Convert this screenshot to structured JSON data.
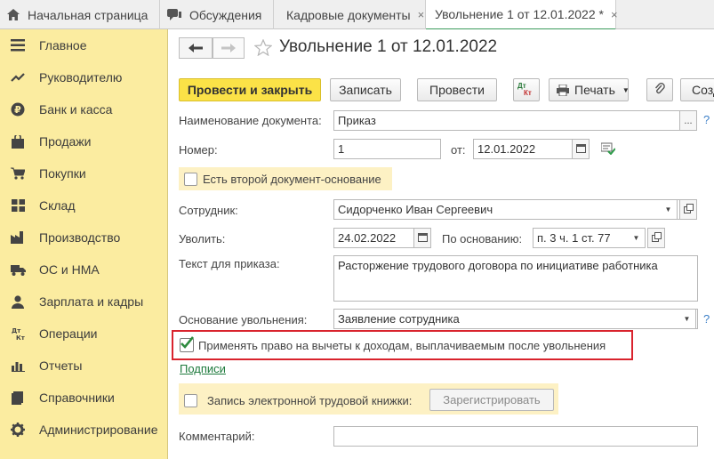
{
  "tabs": [
    {
      "label": "Начальная страница",
      "icon": "home-icon"
    },
    {
      "label": "Обсуждения",
      "icon": "chat-icon"
    },
    {
      "label": "Кадровые документы",
      "icon": ""
    },
    {
      "label": "Увольнение 1 от 12.01.2022 *",
      "icon": "",
      "close": "×"
    }
  ],
  "tab_close": "×",
  "sidebar": {
    "items": [
      {
        "label": "Главное",
        "icon": "menu-lines-icon"
      },
      {
        "label": "Руководителю",
        "icon": "trend-icon"
      },
      {
        "label": "Банк и касса",
        "icon": "ruble-icon"
      },
      {
        "label": "Продажи",
        "icon": "bag-icon"
      },
      {
        "label": "Покупки",
        "icon": "cart-icon"
      },
      {
        "label": "Склад",
        "icon": "grid-icon"
      },
      {
        "label": "Производство",
        "icon": "factory-icon"
      },
      {
        "label": "ОС и НМА",
        "icon": "truck-icon"
      },
      {
        "label": "Зарплата и кадры",
        "icon": "person-icon"
      },
      {
        "label": "Операции",
        "icon": "dt-kt-icon"
      },
      {
        "label": "Отчеты",
        "icon": "bar-chart-icon"
      },
      {
        "label": "Справочники",
        "icon": "book-icon"
      },
      {
        "label": "Администрирование",
        "icon": "gear-icon"
      }
    ]
  },
  "header": {
    "title": "Увольнение 1 от 12.01.2022"
  },
  "toolbar": {
    "post_close": "Провести и закрыть",
    "save": "Записать",
    "post": "Провести",
    "dtkt_top": "Дт",
    "dtkt_bottom": "Кт",
    "print": "Печать",
    "create": "Созд"
  },
  "form": {
    "doc_name_label": "Наименование документа:",
    "doc_name_value": "Приказ",
    "doc_name_btn": "...",
    "number_label": "Номер:",
    "number_value": "1",
    "from_label": "от:",
    "date_value": "12.01.2022",
    "second_basis": "Есть второй документ-основание",
    "employee_label": "Сотрудник:",
    "employee_value": "Сидорченко Иван Сергеевич",
    "dismiss_label": "Уволить:",
    "dismiss_date": "24.02.2022",
    "basis_label": "По основанию:",
    "basis_value": "п. 3 ч. 1 ст. 77",
    "order_text_label": "Текст для приказа:",
    "order_text_value": "Расторжение трудового договора по инициативе работника",
    "reason_label": "Основание увольнения:",
    "reason_value": "Заявление сотрудника",
    "apply_deductions": "Применять право на вычеты к доходам, выплачиваемым после увольнения",
    "signatures_link": "Подписи",
    "e_workbook": "Запись электронной трудовой книжки:",
    "register_btn": "Зарегистрировать",
    "comment_label": "Комментарий:",
    "comment_value": "",
    "help": "?"
  },
  "colors": {
    "sidebar_bg": "#fbeca0",
    "primary_button": "#fbe247",
    "highlight_frame": "#d9232d",
    "link": "#1d7a3c"
  }
}
